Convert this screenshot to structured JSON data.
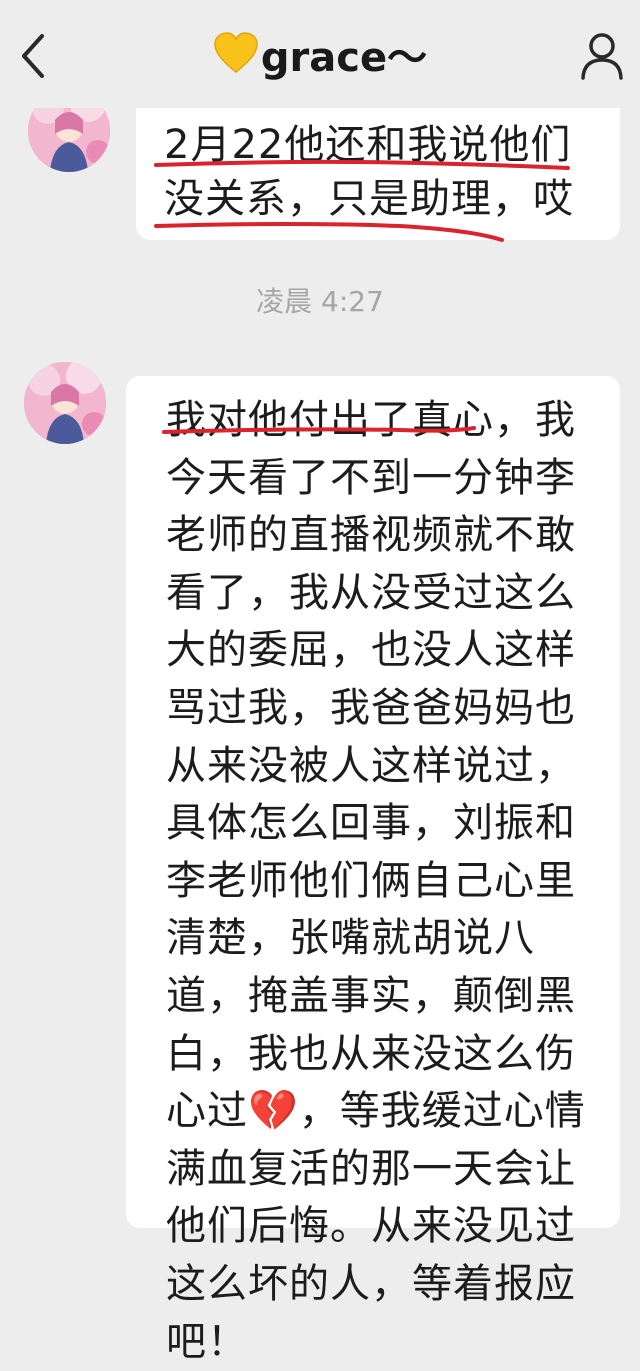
{
  "header": {
    "heart_icon": "yellow-heart-emoji",
    "contact_name": "grace～",
    "back_icon": "chevron-left-icon",
    "profile_icon": "person-icon"
  },
  "messages": [
    {
      "sender": "grace",
      "text": "2月22他还和我说他们没关系，只是助理，哎"
    },
    {
      "text": "凌晨 4:27"
    },
    {
      "sender": "grace",
      "text": "我对他付出了真心，我今天看了不到一分钟李老师的直播视频就不敢看了，我从没受过这么大的委屈，也没人这样骂过我，我爸爸妈妈也从来没被人这样说过，具体怎么回事，刘振和李老师他们俩自己心里清楚，张嘴就胡说八道，掩盖事实，颠倒黑白，我也从来没这么伤心过💔，等我缓过心情满血复活的那一天会让他们后悔。从来没见过这么坏的人，等着报应吧！"
    }
  ],
  "colors": {
    "background": "#ededed",
    "bubble": "#ffffff",
    "annotation_underline": "#d9232d",
    "timestamp": "#a6a6a6"
  }
}
